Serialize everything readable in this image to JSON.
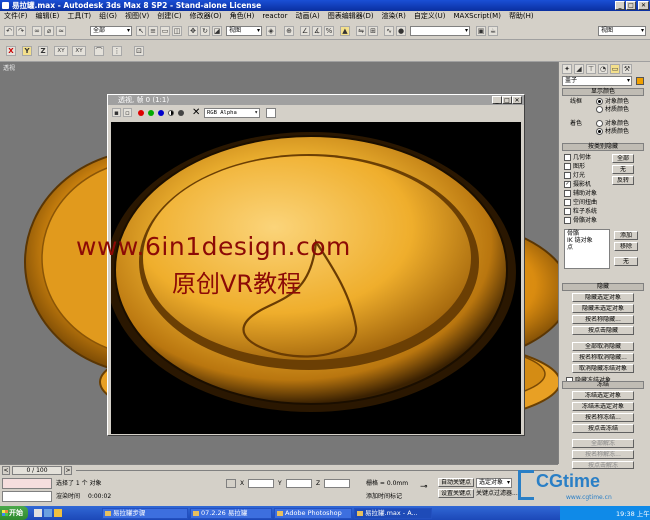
{
  "window": {
    "title": "易拉罐.max - Autodesk 3ds Max 8 SP2 - Stand-alone License"
  },
  "menu": [
    "文件(F)",
    "编辑(E)",
    "工具(T)",
    "组(G)",
    "视图(V)",
    "创建(C)",
    "修改器(O)",
    "角色(H)",
    "reactor",
    "动画(A)",
    "图表编辑器(D)",
    "渲染(R)",
    "自定义(U)",
    "MAXScript(M)",
    "帮助(H)"
  ],
  "toolbar": {
    "filter": "全部",
    "refcoord": "视图",
    "named_sel": "视图"
  },
  "axis_buttons": [
    "X",
    "Y",
    "Z",
    "XY",
    "XY"
  ],
  "viewport": {
    "label": "透视"
  },
  "render_window": {
    "title": "透视, 帧 0 (1:1)",
    "channel": "RGB Alpha",
    "close_x": "✕"
  },
  "watermark": {
    "url": "www.6in1design.com",
    "subtitle": "原创VR教程"
  },
  "command_panel": {
    "name_field": "盖子",
    "rollouts": {
      "display_color": "显示颜色",
      "hide_by_category": "按类别隐藏",
      "hide": "隐藏",
      "freeze": "冻结"
    },
    "wireframe_label": "线框",
    "shaded_label": "着色",
    "object_color": "对象颜色",
    "material_color": "材质颜色",
    "categories": [
      {
        "label": "几何体",
        "checked": false
      },
      {
        "label": "图形",
        "checked": false
      },
      {
        "label": "灯光",
        "checked": false
      },
      {
        "label": "摄影机",
        "checked": true
      },
      {
        "label": "辅助对象",
        "checked": false
      },
      {
        "label": "空间扭曲",
        "checked": false
      },
      {
        "label": "粒子系统",
        "checked": false
      },
      {
        "label": "骨骼对象",
        "checked": false
      }
    ],
    "cat_buttons": {
      "all": "全部",
      "none": "无",
      "invert": "反转"
    },
    "list_items": [
      "骨骼",
      "IK 链对象",
      "点"
    ],
    "list_buttons": {
      "add": "添加",
      "remove": "移除",
      "none": "无"
    },
    "hide_buttons": [
      "隐藏选定对象",
      "隐藏未选定对象",
      "按名称隐藏...",
      "按点击隐藏",
      "全部取消隐藏",
      "按名称取消隐藏...",
      "取消隐藏冻结对象"
    ],
    "hide_frozen": "隐藏冻结对象",
    "freeze_buttons": [
      "冻结选定对象",
      "冻结未选定对象",
      "按名称冻结...",
      "按点击冻结",
      "全部解冻",
      "按名称解冻...",
      "按点击解冻"
    ]
  },
  "timeline": {
    "frame": "0 / 100"
  },
  "status": {
    "selection": "选择了 1 个 对象",
    "render_time_label": "渲染时间",
    "render_time": "0:00:02",
    "grid_label": "栅格 = 0.0mm",
    "auto_key": "自动关键点",
    "set_key": "设置关键点",
    "selected_obj": "选定对象",
    "add_time_tag": "添加时间标记",
    "key_filters": "关键点过滤器..."
  },
  "logo": {
    "text": "CGtime",
    "site": "www.cgtime.cn"
  },
  "taskbar": {
    "start": "开始",
    "items": [
      "易拉罐步骤",
      "07.2.26 易拉罐",
      "Adobe Photoshop",
      "易拉罐.max - A..."
    ],
    "clock": "19:38 上午"
  }
}
